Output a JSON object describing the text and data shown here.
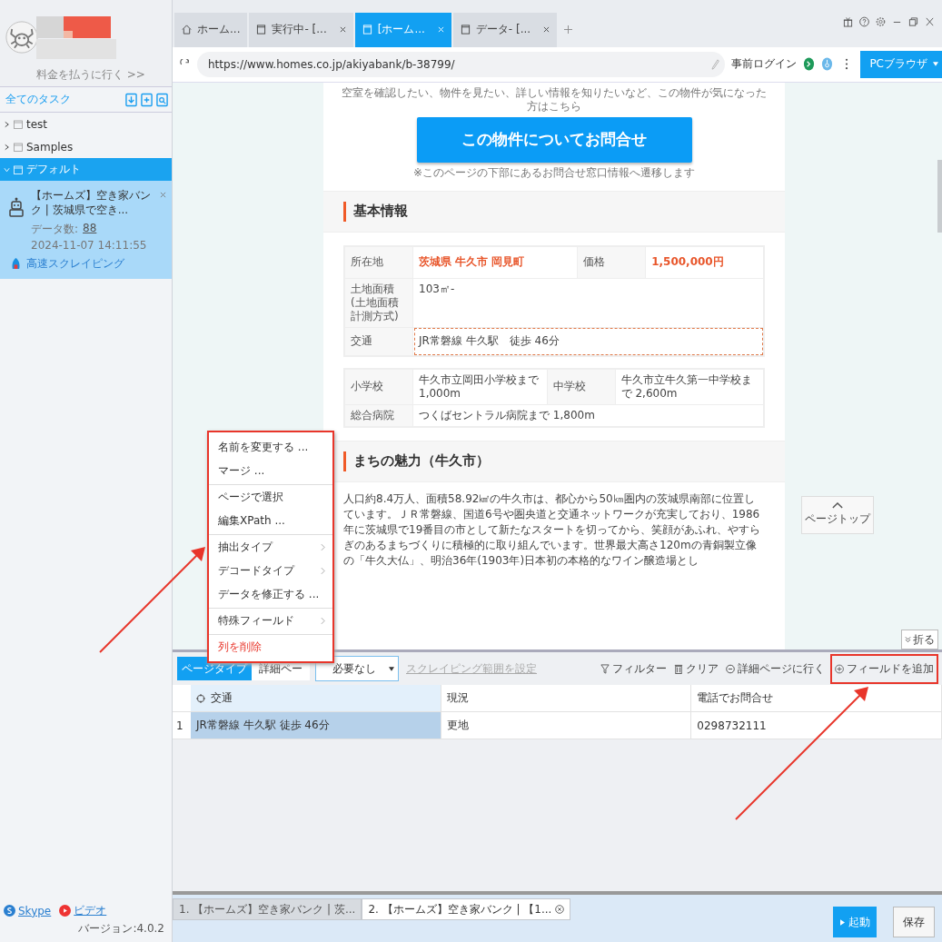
{
  "browser_tabs": [
    {
      "label": "ホーム...",
      "kind": "home",
      "selected": false,
      "closable": false
    },
    {
      "label": "実行中- [...",
      "kind": "page",
      "selected": false,
      "closable": true
    },
    {
      "label": "[ホーム...",
      "kind": "page",
      "selected": true,
      "closable": true
    },
    {
      "label": "データ- [...",
      "kind": "page",
      "selected": false,
      "closable": true
    }
  ],
  "address_bar": {
    "url": "https://www.homes.co.jp/akiyabank/b-38799/",
    "login": "事前ログイン",
    "browser_mode": "PCブラウザ"
  },
  "sidebar": {
    "pay_link": "料金を払うに行く >>",
    "tasks_title": "全てのタスク",
    "folders": [
      {
        "name": "test",
        "expanded": false,
        "selected": false
      },
      {
        "name": "Samples",
        "expanded": false,
        "selected": false
      },
      {
        "name": "デフォルト",
        "expanded": true,
        "selected": true,
        "children": [
          {
            "title": "【ホームズ】空き家バンク | 茨城県で空き...",
            "count_label": "データ数:",
            "count": "88",
            "date": "2024-11-07 14:11:55",
            "mode": "高速スクレイピング",
            "selected": true
          }
        ]
      }
    ],
    "footer_links": [
      "Skype",
      "ビデオ"
    ],
    "version": "バージョン:4.0.2"
  },
  "web_page": {
    "cta_note": "空室を確認したい、物件を見たい、詳しい情報を知りたいなど、この物件が気になった方はこちら",
    "cta_button": "この物件についてお問合せ",
    "cta_subnote": "※このページの下部にあるお問合せ窓口情報へ遷移します",
    "basic_title": "基本情報",
    "basic_rows": [
      {
        "label": "所在地",
        "value": "茨城県 牛久市 岡見町",
        "label_2": "価格",
        "value_2": "1,500,000円",
        "emphasis": true,
        "selected": false
      },
      {
        "label": "土地面積(土地面積計測方式)",
        "value": "103㎡-",
        "emphasis": false,
        "selected": false
      },
      {
        "label": "交通",
        "value": "JR常磐線 牛久駅　徒歩 46分",
        "emphasis": false,
        "selected": true
      }
    ],
    "nearby_rows": [
      {
        "label": "小学校",
        "value": "牛久市立岡田小学校まで 1,000m",
        "label_2": "中学校",
        "value_2": "牛久市立牛久第一中学校まで 2,600m"
      },
      {
        "label": "総合病院",
        "value": "つくばセントラル病院まで 1,800m"
      }
    ],
    "town_title": "まちの魅力（牛久市）",
    "town_text": "人口約8.4万人、面積58.92㎢の牛久市は、都心から50㎞圏内の茨城県南部に位置しています。ＪＲ常磐線、国道6号や圏央道と交通ネットワークが充実しており、1986年に茨城県で19番目の市として新たなスタートを切ってから、笑顔があふれ、やすらぎのあるまちづくりに積極的に取り組んでいます。世界最大高さ120mの青銅製立像の「牛久大仏」、明治36年(1903年)日本初の本格的なワイン醸造場とし",
    "page_top": "ページトップ",
    "fold": "折る"
  },
  "context_menu": {
    "annotated": true,
    "items": [
      {
        "label": "名前を変更する ...",
        "kind": "action",
        "divider_before": false
      },
      {
        "label": "マージ ...",
        "kind": "action",
        "divider_before": false
      },
      {
        "label": "ページで選択",
        "kind": "action",
        "divider_before": true
      },
      {
        "label": "編集XPath ...",
        "kind": "action",
        "divider_before": false
      },
      {
        "label": "抽出タイプ",
        "kind": "submenu",
        "divider_before": true
      },
      {
        "label": "デコードタイプ",
        "kind": "submenu",
        "divider_before": false
      },
      {
        "label": "データを修正する ...",
        "kind": "action",
        "divider_before": false
      },
      {
        "label": "特殊フィールド",
        "kind": "submenu",
        "divider_before": true
      },
      {
        "label": "列を削除",
        "kind": "danger",
        "divider_before": true
      }
    ]
  },
  "data_panel": {
    "page_type_label": "ページタイプ",
    "page_type_value": "詳細ペー",
    "paging": "必要なし",
    "range_link": "スクレイピング範囲を設定",
    "tools": [
      {
        "label": "フィルター",
        "kind": "filter",
        "annotated": false
      },
      {
        "label": "クリア",
        "kind": "clear",
        "annotated": false
      },
      {
        "label": "詳細ページに行く",
        "kind": "goto",
        "annotated": false
      },
      {
        "label": "フィールドを追加",
        "kind": "add",
        "annotated": true
      }
    ],
    "columns": [
      {
        "label": "交通",
        "selected": true
      },
      {
        "label": "現況",
        "selected": false
      },
      {
        "label": "電話でお問合せ",
        "selected": false
      }
    ],
    "rows": [
      {
        "index": "1",
        "cells": [
          "JR常磐線 牛久駅 徒歩 46分",
          "更地",
          "0298732111"
        ]
      }
    ]
  },
  "task_tabs": [
    {
      "label": "1. 【ホームズ】空き家バンク | 茨...",
      "selected": false,
      "closable": false
    },
    {
      "label": "2. 【ホームズ】空き家バンク | 【1...",
      "selected": true,
      "closable": true
    }
  ],
  "actions": {
    "start": "起動",
    "save": "保存"
  }
}
